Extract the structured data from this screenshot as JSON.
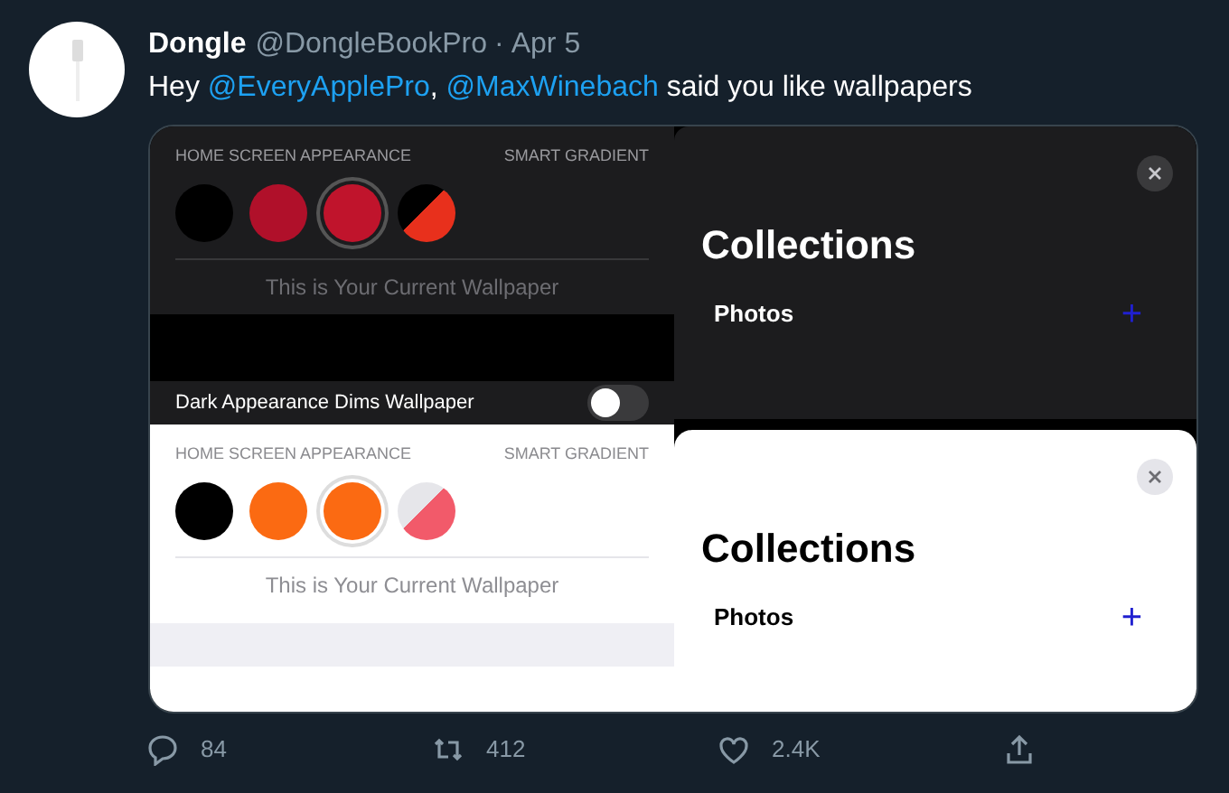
{
  "tweet": {
    "name": "Dongle",
    "handle": "@DongleBookPro",
    "separator": "·",
    "date": "Apr 5",
    "text_parts": [
      {
        "kind": "plain",
        "text": "Hey "
      },
      {
        "kind": "mention",
        "text": "@EveryApplePro"
      },
      {
        "kind": "plain",
        "text": ", "
      },
      {
        "kind": "mention",
        "text": "@MaxWinebach"
      },
      {
        "kind": "plain",
        "text": " said you like wallpapers"
      }
    ]
  },
  "settings_panels": [
    {
      "kind": "dark",
      "section_label": "HOME SCREEN APPEARANCE",
      "mode_label": "SMART GRADIENT",
      "caption": "This is Your Current Wallpaper",
      "toggle_label": "Dark Appearance Dims Wallpaper",
      "toggle_on": false,
      "swatches": [
        {
          "kind": "solid",
          "color": "#000000",
          "selected": false
        },
        {
          "kind": "solid",
          "color": "#b0102a",
          "selected": false
        },
        {
          "kind": "solid",
          "color": "#c0142c",
          "selected": true
        },
        {
          "kind": "split",
          "color": "#e8301c",
          "selected": false
        }
      ]
    },
    {
      "kind": "light",
      "section_label": "HOME SCREEN APPEARANCE",
      "mode_label": "SMART GRADIENT",
      "caption": "This is Your Current Wallpaper",
      "swatches": [
        {
          "kind": "solid",
          "color": "#000000",
          "selected": false
        },
        {
          "kind": "solid",
          "color": "#fb6a12",
          "selected": false
        },
        {
          "kind": "solid",
          "color": "#fb6a12",
          "selected": true
        },
        {
          "kind": "split",
          "color": "#f25a6a",
          "selected": false
        }
      ]
    }
  ],
  "collections_panels": [
    {
      "kind": "dark",
      "title": "Collections",
      "item": "Photos",
      "add": "+"
    },
    {
      "kind": "light",
      "title": "Collections",
      "item": "Photos",
      "add": "+"
    }
  ],
  "actions": [
    {
      "kind": "reply",
      "count": "84"
    },
    {
      "kind": "retweet",
      "count": "412"
    },
    {
      "kind": "like",
      "count": "2.4K"
    },
    {
      "kind": "share"
    }
  ]
}
